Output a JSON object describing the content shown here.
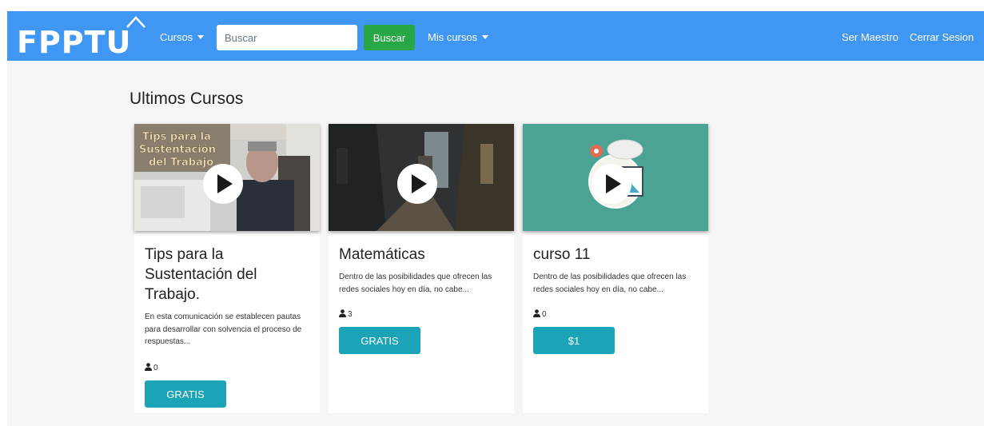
{
  "brand": {
    "logo_text": "FPPTU"
  },
  "nav": {
    "courses_label": "Cursos",
    "search_placeholder": "Buscar",
    "search_button": "Buscar",
    "my_courses_label": "Mis cursos",
    "become_teacher": "Ser Maestro",
    "logout": "Cerrar Sesion"
  },
  "colors": {
    "navbar": "#3f97f3",
    "search_button": "#28a745",
    "price_button": "#1ba4b8"
  },
  "section": {
    "title": "Ultimos Cursos"
  },
  "courses": [
    {
      "thumbnail_caption": "Tips para la Sustentación del Trabajo",
      "title": "Tips para la Sustentación del Trabajo.",
      "description": "En esta comunicación se establecen pautas para desarrollar con solvencia el proceso de respuestas...",
      "students": "0",
      "price": "GRATIS"
    },
    {
      "title": "Matemáticas",
      "description": "Dentro de las posibilidades que ofrecen las redes sociales hoy en día, no cabe...",
      "students": "3",
      "price": "GRATIS"
    },
    {
      "title": "curso 11",
      "description": "Dentro de las posibilidades que ofrecen las redes sociales hoy en día, no cabe...",
      "students": "0",
      "price": "$1"
    }
  ]
}
